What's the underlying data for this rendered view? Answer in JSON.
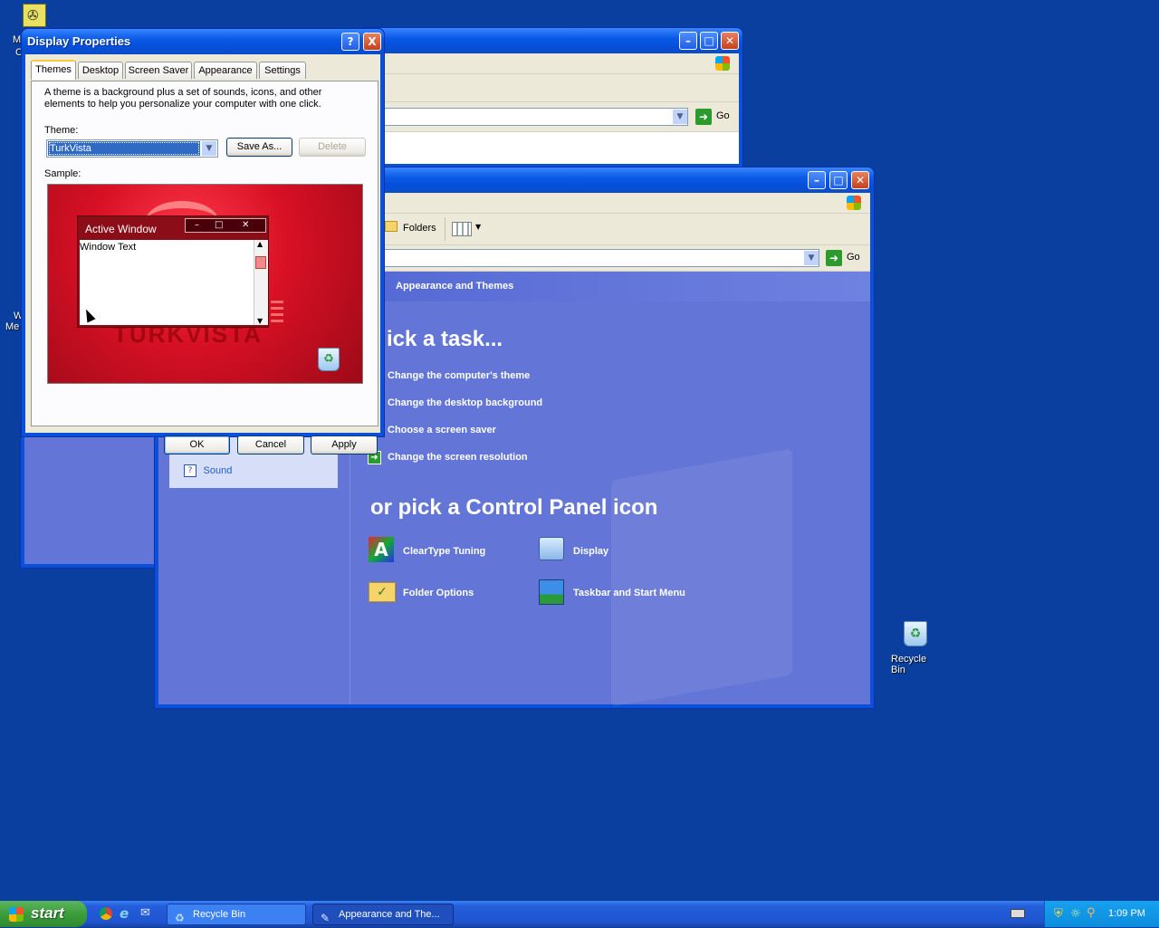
{
  "desktop": {
    "recycle_bin_label": "Recycle Bin",
    "left_clip_texts": [
      "M",
      "C",
      "W",
      "Me"
    ]
  },
  "back_window": {
    "go_label": "Go"
  },
  "cp_window": {
    "toolbar": {
      "folders_label": "Folders"
    },
    "address_go_label": "Go",
    "header_title": "Appearance and Themes",
    "pick_task_heading": "ick a task...",
    "tasks": [
      "Change the computer's theme",
      "Change the desktop background",
      "Choose a screen saver",
      "Change the screen resolution"
    ],
    "icon_heading": "or pick a Control Panel icon",
    "icons": [
      "ClearType Tuning",
      "Display",
      "Folder Options",
      "Taskbar and Start Menu"
    ],
    "sidebar_sound_label": "Sound"
  },
  "dialog": {
    "title": "Display Properties",
    "help_button": "?",
    "close_button": "X",
    "tabs": [
      "Themes",
      "Desktop",
      "Screen Saver",
      "Appearance",
      "Settings"
    ],
    "description": "A theme is a background plus a set of sounds, icons, and other elements to help you personalize your computer with one click.",
    "theme_label": "Theme:",
    "theme_value": "TurkVista",
    "save_as_label": "Save As...",
    "delete_label": "Delete",
    "sample_label": "Sample:",
    "sample": {
      "active_window_title": "Active Window",
      "window_text": "Window Text",
      "brand_text": "TURKVISTA"
    },
    "ok_label": "OK",
    "cancel_label": "Cancel",
    "apply_label": "Apply"
  },
  "taskbar": {
    "start_label": "start",
    "tasks": [
      "Recycle Bin",
      "Appearance and The..."
    ],
    "clock": "1:09 PM"
  },
  "colors": {
    "desktop": "#0a3fa0",
    "cp_panel": "#6375d6",
    "sample_red": "#c8102e",
    "taskbar": "#245edb",
    "start_green": "#3c9d3c"
  }
}
